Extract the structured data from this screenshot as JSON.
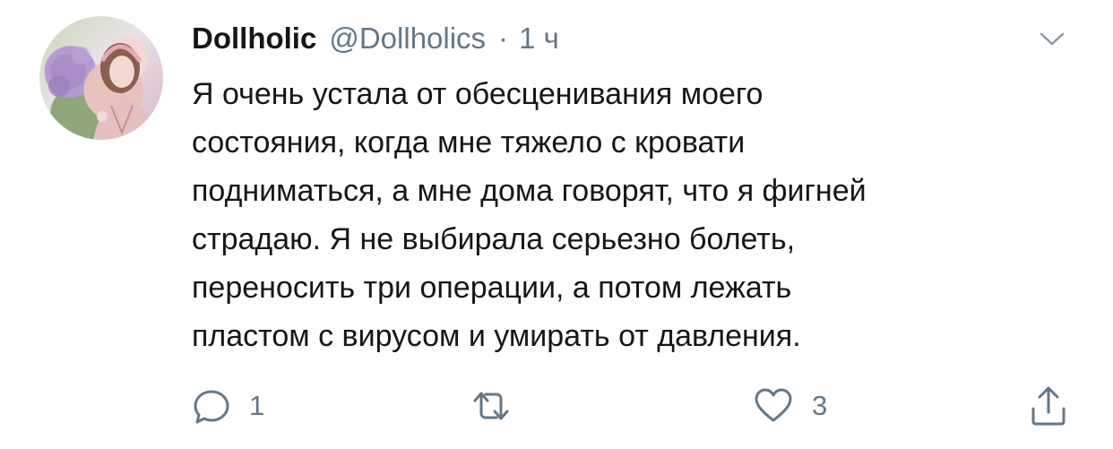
{
  "tweet": {
    "author_name": "Dollholic",
    "author_handle": "@Dollholics",
    "separator": "·",
    "time": "1 ч",
    "text_lines": [
      "Я очень устала от обесценивания моего",
      "состояния, когда мне тяжело с кровати",
      "подниматься, а мне дома говорят, что я фигней",
      "страдаю. Я не выбирала серьезно болеть,",
      "переносить три операции, а потом лежать",
      "пластом с вирусом и умирать от давления."
    ],
    "reply_count": "1",
    "like_count": "3"
  },
  "icons": {
    "avatar": "avatar",
    "caret": "chevron-down-icon",
    "reply": "reply-icon",
    "retweet": "retweet-icon",
    "like": "heart-icon",
    "share": "share-icon"
  },
  "colors": {
    "text": "#14171a",
    "secondary": "#657786"
  }
}
